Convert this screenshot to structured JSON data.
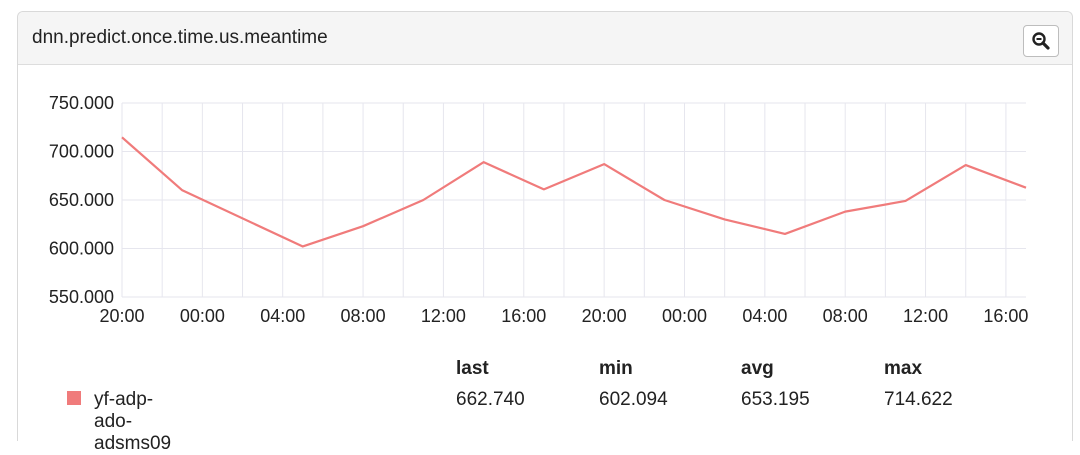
{
  "panel": {
    "title": "dnn.predict.once.time.us.meantime",
    "zoom_icon": "zoom-out-icon"
  },
  "chart_data": {
    "type": "line",
    "title": "",
    "xlabel": "",
    "ylabel": "",
    "ylim": [
      550,
      750
    ],
    "yticks": [
      "550.000",
      "600.000",
      "650.000",
      "700.000",
      "750.000"
    ],
    "xticks": [
      "20:00",
      "00:00",
      "04:00",
      "08:00",
      "12:00",
      "16:00",
      "20:00",
      "00:00",
      "04:00",
      "08:00",
      "12:00",
      "16:00"
    ],
    "x_hours": [
      0,
      3,
      9,
      12,
      15,
      18,
      21,
      24,
      27,
      30,
      33,
      36,
      39,
      42,
      45
    ],
    "series": [
      {
        "name": "yf-adp-ado-adsms09",
        "color": "#f07b7b",
        "values": [
          714.6,
          660,
          602.1,
          623,
          650,
          689,
          661,
          687,
          650,
          630,
          615,
          638,
          649,
          686,
          662.7
        ]
      }
    ],
    "grid": true
  },
  "legend": {
    "headers": [
      "last",
      "min",
      "avg",
      "max"
    ],
    "rows": [
      {
        "name": "yf-adp-ado-adsms09",
        "color": "#f07b7b",
        "last": "662.740",
        "min": "602.094",
        "avg": "653.195",
        "max": "714.622"
      }
    ]
  }
}
